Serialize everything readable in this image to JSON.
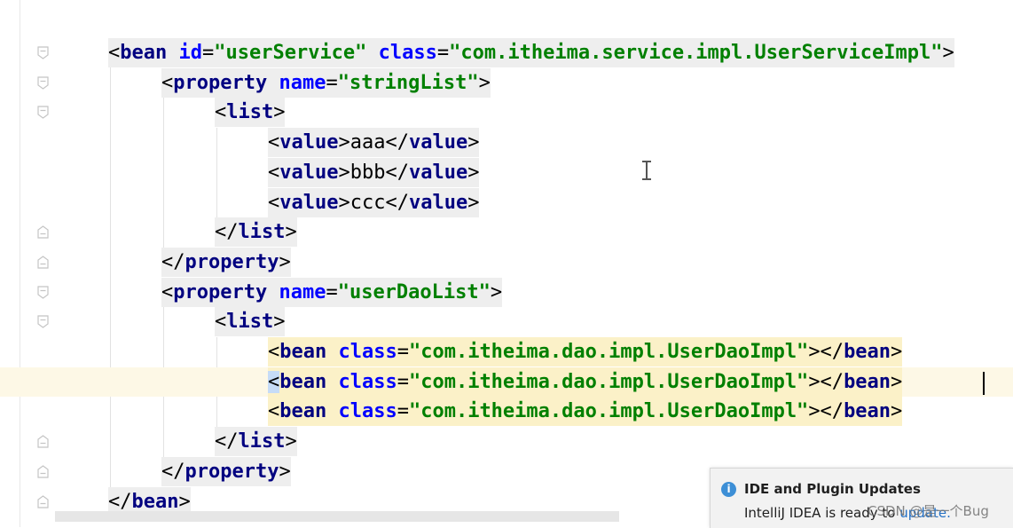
{
  "editor": {
    "lines": [
      {
        "parts": [
          [
            "angle",
            "<"
          ],
          [
            "tag",
            "bean"
          ],
          [
            "txt",
            " "
          ],
          [
            "attr",
            "id"
          ],
          [
            "angle",
            "="
          ],
          [
            "val",
            "\"userService\""
          ],
          [
            "txt",
            " "
          ],
          [
            "attr",
            "class"
          ],
          [
            "angle",
            "="
          ],
          [
            "val",
            "\"com.itheima.service.impl.UserServiceImpl\""
          ],
          [
            "angle",
            ">"
          ]
        ]
      },
      {
        "parts": [
          [
            "angle",
            "<"
          ],
          [
            "tag",
            "property"
          ],
          [
            "txt",
            " "
          ],
          [
            "attr",
            "name"
          ],
          [
            "angle",
            "="
          ],
          [
            "val",
            "\"stringList\""
          ],
          [
            "angle",
            ">"
          ]
        ]
      },
      {
        "parts": [
          [
            "angle",
            "<"
          ],
          [
            "tag",
            "list"
          ],
          [
            "angle",
            ">"
          ]
        ]
      },
      {
        "parts": [
          [
            "angle",
            "<"
          ],
          [
            "tag",
            "value"
          ],
          [
            "angle",
            ">"
          ],
          [
            "txt",
            "aaa"
          ],
          [
            "angle",
            "</"
          ],
          [
            "tag",
            "value"
          ],
          [
            "angle",
            ">"
          ]
        ]
      },
      {
        "parts": [
          [
            "angle",
            "<"
          ],
          [
            "tag",
            "value"
          ],
          [
            "angle",
            ">"
          ],
          [
            "txt",
            "bbb"
          ],
          [
            "angle",
            "</"
          ],
          [
            "tag",
            "value"
          ],
          [
            "angle",
            ">"
          ]
        ]
      },
      {
        "parts": [
          [
            "angle",
            "<"
          ],
          [
            "tag",
            "value"
          ],
          [
            "angle",
            ">"
          ],
          [
            "txt",
            "ccc"
          ],
          [
            "angle",
            "</"
          ],
          [
            "tag",
            "value"
          ],
          [
            "angle",
            ">"
          ]
        ]
      },
      {
        "parts": [
          [
            "angle",
            "</"
          ],
          [
            "tag",
            "list"
          ],
          [
            "angle",
            ">"
          ]
        ]
      },
      {
        "parts": [
          [
            "angle",
            "</"
          ],
          [
            "tag",
            "property"
          ],
          [
            "angle",
            ">"
          ]
        ]
      },
      {
        "parts": [
          [
            "angle",
            "<"
          ],
          [
            "tag",
            "property"
          ],
          [
            "txt",
            " "
          ],
          [
            "attr",
            "name"
          ],
          [
            "angle",
            "="
          ],
          [
            "val",
            "\"userDaoList\""
          ],
          [
            "angle",
            ">"
          ]
        ]
      },
      {
        "parts": [
          [
            "angle",
            "<"
          ],
          [
            "tag",
            "list"
          ],
          [
            "angle",
            ">"
          ]
        ]
      },
      {
        "parts": [
          [
            "angle",
            "<"
          ],
          [
            "tag",
            "bean"
          ],
          [
            "txt",
            " "
          ],
          [
            "attr",
            "class"
          ],
          [
            "angle",
            "="
          ],
          [
            "val",
            "\"com.itheima.dao.impl.UserDaoImpl\""
          ],
          [
            "angle",
            "></"
          ],
          [
            "tag",
            "bean"
          ],
          [
            "angle",
            ">"
          ]
        ]
      },
      {
        "parts": [
          [
            "angle",
            "<"
          ],
          [
            "tag",
            "bean"
          ],
          [
            "txt",
            " "
          ],
          [
            "attr",
            "class"
          ],
          [
            "angle",
            "="
          ],
          [
            "val",
            "\"com.itheima.dao.impl.UserDaoImpl\""
          ],
          [
            "angle",
            "></"
          ],
          [
            "tag",
            "bean"
          ],
          [
            "angle",
            ">"
          ]
        ]
      },
      {
        "parts": [
          [
            "angle",
            "<"
          ],
          [
            "tag",
            "bean"
          ],
          [
            "txt",
            " "
          ],
          [
            "attr",
            "class"
          ],
          [
            "angle",
            "="
          ],
          [
            "val",
            "\"com.itheima.dao.impl.UserDaoImpl\""
          ],
          [
            "angle",
            "></"
          ],
          [
            "tag",
            "bean"
          ],
          [
            "angle",
            ">"
          ]
        ]
      },
      {
        "parts": [
          [
            "angle",
            "</"
          ],
          [
            "tag",
            "list"
          ],
          [
            "angle",
            ">"
          ]
        ]
      },
      {
        "parts": [
          [
            "angle",
            "</"
          ],
          [
            "tag",
            "property"
          ],
          [
            "angle",
            ">"
          ]
        ]
      },
      {
        "parts": [
          [
            "angle",
            "</"
          ],
          [
            "tag",
            "bean"
          ],
          [
            "angle",
            ">"
          ]
        ]
      }
    ]
  },
  "notification": {
    "title": "IDE and Plugin Updates",
    "body_prefix": "IntelliJ IDEA is ready to ",
    "link": "update."
  },
  "watermark": "CSDN @是一个Bug",
  "colors": {
    "tag": "#000080",
    "attribute": "#0000ff",
    "attribute_value": "#008000",
    "current_line": "#fdf8e6",
    "highlight": "#fbf1c8",
    "notification_bg": "#f2f2f2",
    "link": "#2470c4"
  },
  "icons": {
    "notification": "info-icon",
    "cursor": "text-cursor-icon"
  }
}
